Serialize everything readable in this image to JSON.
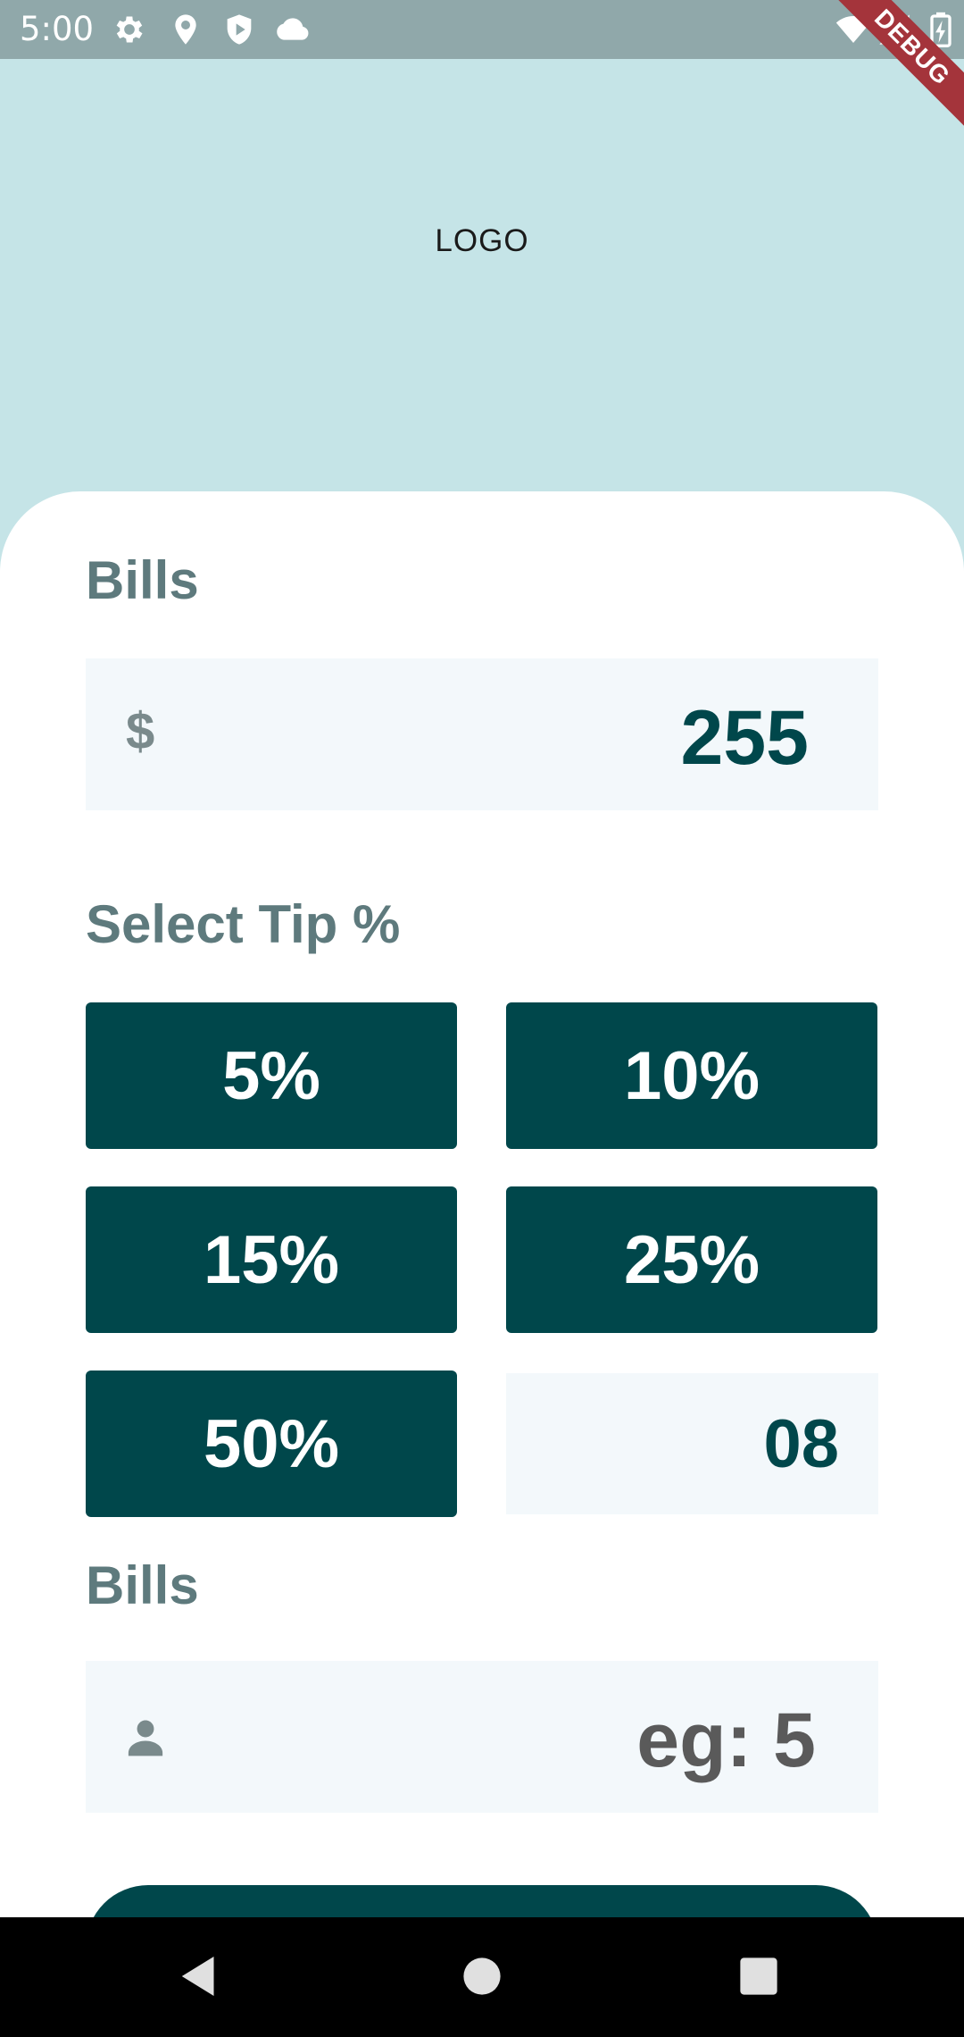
{
  "status_bar": {
    "time": "5:00",
    "icons": [
      "gear-icon",
      "location-pin-icon",
      "shield-play-icon",
      "cloud-icon",
      "wifi-icon",
      "signal-icon",
      "battery-charging-icon"
    ],
    "debug_label": "DEBUG"
  },
  "header": {
    "logo_text": "LOGO"
  },
  "bill": {
    "label": "Bills",
    "prefix": "$",
    "value": "255"
  },
  "tip": {
    "label": "Select Tip %",
    "options": [
      "5%",
      "10%",
      "15%",
      "25%",
      "50%"
    ],
    "custom_value": "08"
  },
  "people": {
    "label": "Bills",
    "placeholder": "eg: 5",
    "icon": "person-icon"
  },
  "colors": {
    "header_bg": "#c5e4e7",
    "accent_dark_teal": "#00474b",
    "label_gray": "#5e7a7d",
    "input_bg": "#f3f8fb",
    "status_bar_bg": "#90a8aa"
  },
  "nav_bar": {
    "buttons": [
      "back-icon",
      "home-icon",
      "recents-icon"
    ]
  }
}
